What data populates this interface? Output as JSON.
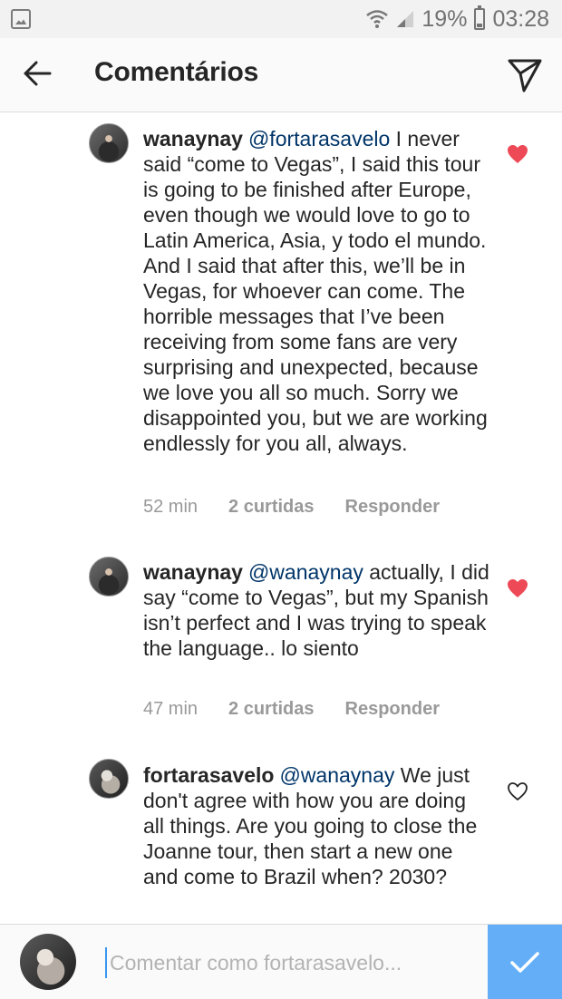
{
  "status_bar": {
    "battery_percent": "19%",
    "time": "03:28",
    "icons": [
      "gallery-icon",
      "wifi-icon",
      "signal-icon",
      "battery-icon"
    ]
  },
  "header": {
    "title": "Comentários",
    "icons": [
      "back-arrow-icon",
      "direct-message-icon"
    ]
  },
  "comments": [
    {
      "username": "wanaynay",
      "mention": "@fortarasavelo",
      "text": " I never said “come to Vegas”, I said this tour is going to be finished after Europe, even though we would love to go to Latin America, Asia, y todo el mundo. And I said that after this, we’ll be in Vegas, for whoever can come. The horrible messages that I’ve been receiving from some fans are very surprising and unexpected, because we love you all so much. Sorry we disappointed you, but we are working endlessly for you all, always.",
      "time": "52 min",
      "likes": "2 curtidas",
      "reply": "Responder",
      "liked": true
    },
    {
      "username": "wanaynay",
      "mention": "@wanaynay",
      "text": " actually, I did say “come to Vegas”, but my Spanish isn’t perfect and I was trying to speak the language.. lo siento",
      "time": "47 min",
      "likes": "2 curtidas",
      "reply": "Responder",
      "liked": true
    },
    {
      "username": "fortarasavelo",
      "mention": "@wanaynay",
      "text": " We just don't agree with how you are doing all things. Are you going to close the Joanne tour, then start a new one and come to Brazil when? 2030?",
      "liked": false
    }
  ],
  "composer": {
    "placeholder": "Comentar como fortarasavelo...",
    "value": ""
  },
  "colors": {
    "accent": "#3897f0",
    "send_button": "#63aef7",
    "heart_liked": "#ed4956",
    "mention": "#003569",
    "meta_text": "#999999"
  }
}
